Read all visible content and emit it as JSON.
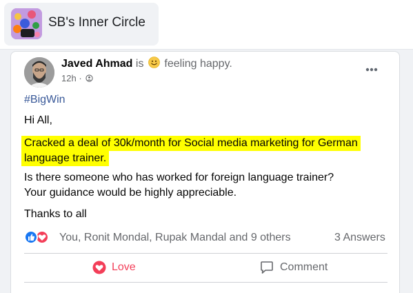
{
  "group": {
    "name": "SB's Inner Circle"
  },
  "post": {
    "author": "Javed Ahmad",
    "is_word": "is",
    "feeling": "feeling happy.",
    "time": "12h",
    "separator": "·",
    "hashtag": "#BigWin",
    "greeting": "Hi All,",
    "highlight_line1": "Cracked a deal of 30k/month for Social media marketing for German",
    "highlight_line2": "language trainer.",
    "question_line1": "Is there someone who has worked for foreign language trainer?",
    "question_line2": "Your guidance would be highly appreciable.",
    "closing": "Thanks to all",
    "highlight_color": "#ffff00"
  },
  "reactions": {
    "summary": "You, Ronit Mondal, Rupak Mandal and 9 others",
    "answers": "3 Answers",
    "icons": [
      "like-icon",
      "love-icon"
    ]
  },
  "actions": {
    "love_label": "Love",
    "comment_label": "Comment"
  },
  "colors": {
    "love": "#f33e58",
    "like": "#1877f2",
    "hashtag": "#385898",
    "muted": "#65676b"
  }
}
